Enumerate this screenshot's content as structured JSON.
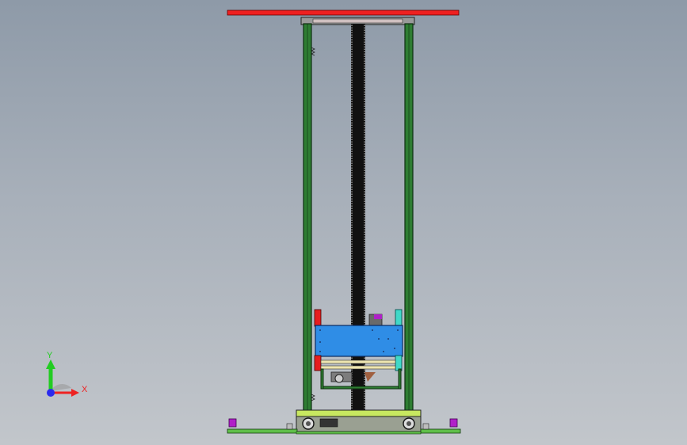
{
  "viewport": {
    "background_top": "#8e9aa8",
    "background_bottom": "#c2c6cb"
  },
  "triad": {
    "y_label": "Y",
    "x_label": "X",
    "y_color": "#22cc22",
    "x_color": "#ee2222",
    "origin_color": "#2a2aee"
  },
  "model": {
    "top_plate_color": "#ee2020",
    "frame_color": "#2e7d32",
    "frame_edge_color": "#0d2e10",
    "screw_color": "#111111",
    "carriage_color": "#2f8de6",
    "platform_color": "#c8e860",
    "base_color": "#5fbf4a",
    "pad_color": "#b020c8",
    "accent_red": "#e61e1e",
    "accent_cyan": "#40d8c8",
    "bracket_color": "#a06040"
  }
}
